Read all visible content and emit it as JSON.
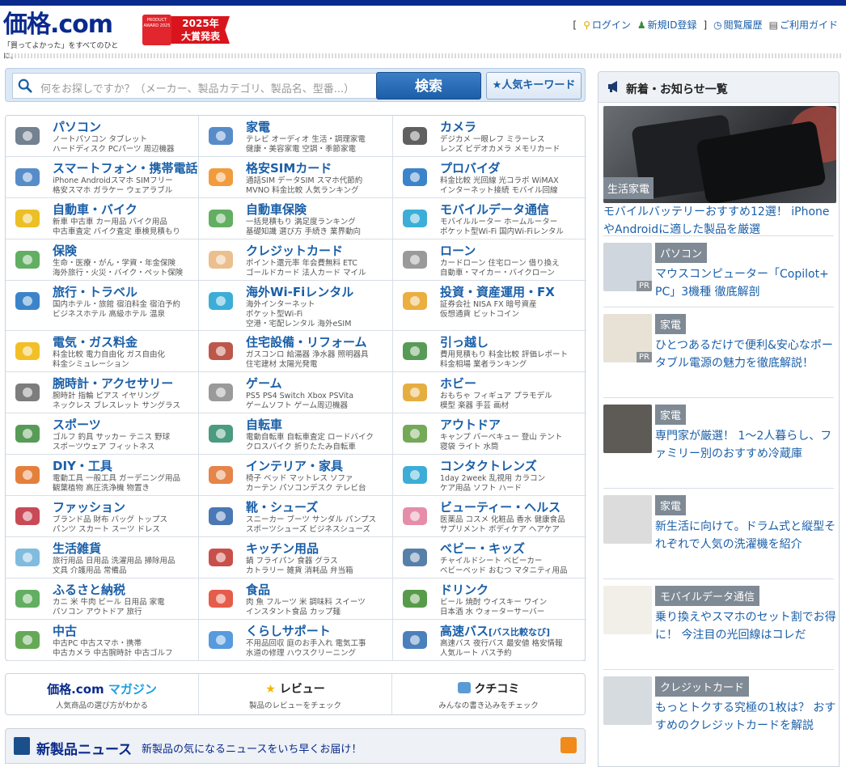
{
  "header": {
    "logo": "価格.com",
    "tagline": "「買ってよかった」をすべてのひとに。",
    "award_badge": "PRODUCT AWARD 2025",
    "award_text_line1": "2025年",
    "award_text_line2": "大賞発表",
    "links": [
      "ログイン",
      "新規ID登録",
      "閲覧履歴",
      "ご利用ガイド"
    ],
    "bracket_open": "[",
    "bracket_close": "]"
  },
  "search": {
    "placeholder": "何をお探しですか？（メーカー、製品カテゴリ、製品名、型番...）",
    "button": "検索",
    "keyword_button": "★人気キーワード"
  },
  "categories": [
    {
      "title": "パソコン",
      "sub1": "ノートパソコン  タブレット",
      "sub2": "ハードディスク  PCパーツ  周辺機器",
      "icon": "laptop-icon"
    },
    {
      "title": "家電",
      "sub1": "テレビ  オーディオ  生活・調理家電",
      "sub2": "健康・美容家電  空調・季節家電",
      "icon": "tv-icon"
    },
    {
      "title": "カメラ",
      "sub1": "デジカメ  一眼レフ  ミラーレス",
      "sub2": "レンズ  ビデオカメラ  メモリカード",
      "icon": "camera-icon"
    },
    {
      "title": "スマートフォン・携帯電話",
      "sub1": "iPhone  Androidスマホ  SIMフリー",
      "sub2": "格安スマホ  ガラケー  ウェアラブル",
      "icon": "smartphone-icon"
    },
    {
      "title": "格安SIMカード",
      "sub1": "通話SIM  データSIM  スマホ代節約",
      "sub2": "MVNO  料金比較  人気ランキング",
      "icon": "sim-card-icon"
    },
    {
      "title": "プロバイダ",
      "sub1": "料金比較  光回線  光コラボ  WiMAX",
      "sub2": "インターネット接続  モバイル回線",
      "icon": "globe-icon"
    },
    {
      "title": "自動車・バイク",
      "sub1": "新車  中古車  カー用品  バイク用品",
      "sub2": "中古車査定  バイク査定  車検見積もり",
      "icon": "car-icon"
    },
    {
      "title": "自動車保険",
      "sub1": "一括見積もり  満足度ランキング",
      "sub2": "基礎知識  選び方  手続き  業界動向",
      "icon": "clover-car-icon"
    },
    {
      "title": "モバイルデータ通信",
      "sub1": "モバイルルーター  ホームルーター",
      "sub2": "ポケット型Wi-Fi  国内Wi-Fiレンタル",
      "icon": "wifi-icon"
    },
    {
      "title": "保険",
      "sub1": "生命・医療・がん・学資・年金保険",
      "sub2": "海外旅行・火災・バイク・ペット保険",
      "icon": "clover-icon"
    },
    {
      "title": "クレジットカード",
      "sub1": "ポイント還元率  年会費無料  ETC",
      "sub2": "ゴールドカード  法人カード  マイル",
      "icon": "credit-card-icon"
    },
    {
      "title": "ローン",
      "sub1": "カードローン  住宅ローン  借り換え",
      "sub2": "自動車・マイカー・バイクローン",
      "icon": "calculator-icon"
    },
    {
      "title": "旅行・トラベル",
      "sub1": "国内ホテル・旅館  宿泊料金  宿泊予約",
      "sub2": "ビジネスホテル  高級ホテル  温泉",
      "icon": "airplane-icon"
    },
    {
      "title": "海外Wi-Fiレンタル",
      "sub1": "海外インターネット",
      "sub2": "ポケット型Wi-Fi",
      "sub3": "空港・宅配レンタル  海外eSIM",
      "icon": "wifi-plane-icon"
    },
    {
      "title": "投資・資産運用・FX",
      "sub1": "証券会社  NISA  FX  暗号資産",
      "sub2": "仮想通貨  ビットコイン",
      "icon": "chart-yen-icon"
    },
    {
      "title": "電気・ガス料金",
      "sub1": "料金比較  電力自由化  ガス自由化",
      "sub2": "料金シミュレーション",
      "icon": "bulb-flame-icon"
    },
    {
      "title": "住宅設備・リフォーム",
      "sub1": "ガスコンロ  給湯器  浄水器  照明器具",
      "sub2": "住宅建材  太陽光発電",
      "icon": "house-icon"
    },
    {
      "title": "引っ越し",
      "sub1": "費用見積もり  料金比較  評価レポート",
      "sub2": "料金相場  業者ランキング",
      "icon": "truck-icon"
    },
    {
      "title": "腕時計・アクセサリー",
      "sub1": "腕時計  指輪  ピアス  イヤリング",
      "sub2": "ネックレス  ブレスレット  サングラス",
      "icon": "watch-icon"
    },
    {
      "title": "ゲーム",
      "sub1": "PS5  PS4  Switch  Xbox  PSVita",
      "sub2": "ゲームソフト  ゲーム周辺機器",
      "icon": "gamepad-icon"
    },
    {
      "title": "ホビー",
      "sub1": "おもちゃ  フィギュア  プラモデル",
      "sub2": "模型  楽器  手芸  画材",
      "icon": "robot-icon"
    },
    {
      "title": "スポーツ",
      "sub1": "ゴルフ  釣具  サッカー  テニス  野球",
      "sub2": "スポーツウェア  フィットネス",
      "icon": "golf-icon"
    },
    {
      "title": "自転車",
      "sub1": "電動自転車  自転車査定  ロードバイク",
      "sub2": "クロスバイク  折りたたみ自転車",
      "icon": "bicycle-icon"
    },
    {
      "title": "アウトドア",
      "sub1": "キャンプ  バーベキュー  登山  テント",
      "sub2": "寝袋  ライト  水筒",
      "icon": "tent-icon"
    },
    {
      "title": "DIY・工具",
      "sub1": "電動工具  一般工具  ガーデニング用品",
      "sub2": "観葉植物  高圧洗浄機  物置き",
      "icon": "drill-icon"
    },
    {
      "title": "インテリア・家具",
      "sub1": "椅子  ベッド  マットレス  ソファ",
      "sub2": "カーテン  パソコンデスク  テレビ台",
      "icon": "chair-icon"
    },
    {
      "title": "コンタクトレンズ",
      "sub1": "1day  2week  乱視用  カラコン",
      "sub2": "ケア用品  ソフト  ハード",
      "icon": "contact-lens-icon"
    },
    {
      "title": "ファッション",
      "sub1": "ブランド品  財布  バッグ  トップス",
      "sub2": "パンツ  スカート  スーツ  ドレス",
      "icon": "dress-icon"
    },
    {
      "title": "靴・シューズ",
      "sub1": "スニーカー  ブーツ  サンダル  パンプス",
      "sub2": "スポーツシューズ  ビジネスシューズ",
      "icon": "shoe-icon"
    },
    {
      "title": "ビューティー・ヘルス",
      "sub1": "医薬品  コスメ  化粧品  香水  健康食品",
      "sub2": "サプリメント  ボディケア  ヘアケア",
      "icon": "cosmetics-icon"
    },
    {
      "title": "生活雑貨",
      "sub1": "旅行用品  日用品  洗濯用品  掃除用品",
      "sub2": "文具  介護用品  常備品",
      "icon": "spray-icon"
    },
    {
      "title": "キッチン用品",
      "sub1": "鍋  フライパン  食器  グラス",
      "sub2": "カトラリー  雑貨  消耗品  弁当箱",
      "icon": "pot-icon"
    },
    {
      "title": "ベビー・キッズ",
      "sub1": "チャイルドシート  ベビーカー",
      "sub2": "ベビーベッド  おむつ  マタニティ用品",
      "icon": "stroller-icon"
    },
    {
      "title": "ふるさと納税",
      "sub1": "カニ  米  牛肉  ビール  日用品  家電",
      "sub2": "パソコン  アウトドア  旅行",
      "icon": "hometown-tax-icon"
    },
    {
      "title": "食品",
      "sub1": "肉  魚  フルーツ  米  調味料  スイーツ",
      "sub2": "インスタント食品  カップ麺",
      "icon": "crab-icon"
    },
    {
      "title": "ドリンク",
      "sub1": "ビール  焼酎  ウイスキー  ワイン",
      "sub2": "日本酒  水  ウォーターサーバー",
      "icon": "bottle-icon"
    },
    {
      "title": "中古",
      "sub1": "中古PC  中古スマホ・携帯",
      "sub2": "中古カメラ  中古腕時計  中古ゴルフ",
      "icon": "used-icon"
    },
    {
      "title": "くらしサポート",
      "sub1": "不用品回収  庭のお手入れ  電気工事",
      "sub2": "水道の修理  ハウスクリーニング",
      "icon": "worker-icon"
    },
    {
      "title": "高速バス",
      "title_small": "[バス比較なび]",
      "sub1": "高速バス  夜行バス  最安値  格安情報",
      "sub2": "人気ルート  バス予約",
      "icon": "bus-icon"
    }
  ],
  "bottom_links": [
    {
      "title_a": "価格.com",
      "title_b": "マガジン",
      "sub": "人気商品の選び方がわかる"
    },
    {
      "title": "レビュー",
      "sub": "製品のレビューをチェック"
    },
    {
      "title": "クチコミ",
      "sub": "みんなの書き込みをチェック"
    }
  ],
  "news_bar": {
    "title": "新製品ニュース",
    "sub": "新製品の気になるニュースをいち早くお届け！"
  },
  "sidebar": {
    "title": "新着・お知らせ一覧",
    "feature": {
      "tag": "生活家電",
      "text": "モバイルバッテリーおすすめ12選！ iPhoneやAndroidに適した製品を厳選"
    },
    "items": [
      {
        "tag": "パソコン",
        "text": "マウスコンピューター「Copilot+ PC」3機種 徹底解剖",
        "pr": "PR"
      },
      {
        "tag": "家電",
        "text": "ひとつあるだけで便利&安心なポータブル電源の魅力を徹底解説！",
        "pr": "PR"
      },
      {
        "tag": "家電",
        "text": "専門家が厳選！ 1～2人暮らし、ファミリー別のおすすめ冷蔵庫"
      },
      {
        "tag": "家電",
        "text": "新生活に向けて。ドラム式と縦型それぞれで人気の洗濯機を紹介"
      },
      {
        "tag": "モバイルデータ通信",
        "text": "乗り換えやスマホのセット割でお得に！ 今注目の光回線はコレだ"
      },
      {
        "tag": "クレジットカード",
        "text": "もっとトクする究極の1枚は？ おすすめのクレジットカードを解説"
      }
    ]
  }
}
